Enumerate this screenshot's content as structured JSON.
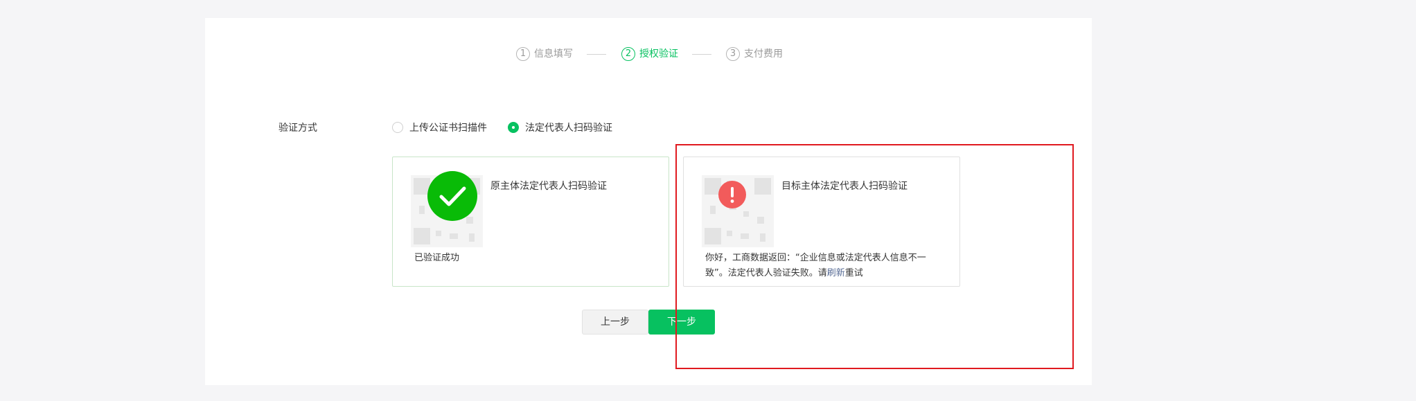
{
  "steps": [
    {
      "num": "1",
      "label": "信息填写",
      "state": "done"
    },
    {
      "num": "2",
      "label": "授权验证",
      "state": "active"
    },
    {
      "num": "3",
      "label": "支付费用",
      "state": "pending"
    }
  ],
  "form": {
    "method_label": "验证方式",
    "options": [
      {
        "label": "上传公证书扫描件",
        "checked": false
      },
      {
        "label": "法定代表人扫码验证",
        "checked": true
      }
    ]
  },
  "cards": {
    "source": {
      "title": "原主体法定代表人扫码验证",
      "status": "已验证成功"
    },
    "target": {
      "title": "目标主体法定代表人扫码验证",
      "message_line1": "你好，工商数据返回：“企业信息或法定代表人信息不一",
      "message_line2_prefix": "致”。法定代表人验证失败。请",
      "refresh_link": "刷新",
      "message_line2_suffix": "重试"
    }
  },
  "buttons": {
    "prev": "上一步",
    "next": "下一步"
  },
  "colors": {
    "primary": "#07c160",
    "error": "#f25b5b",
    "highlight": "#e0191f",
    "link": "#576b95"
  }
}
